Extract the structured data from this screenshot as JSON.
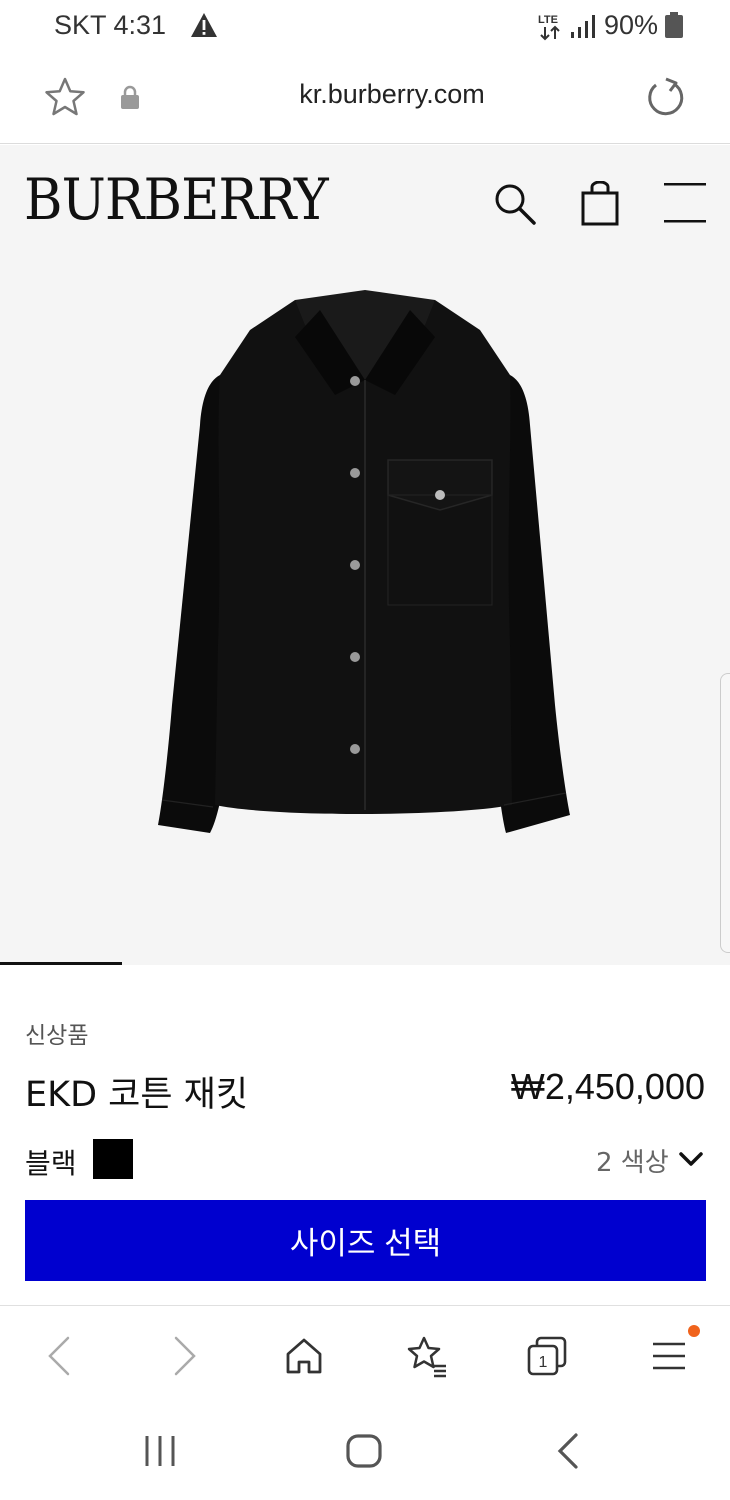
{
  "status_bar": {
    "carrier_time": "SKT 4:31",
    "battery": "90%",
    "icons": [
      "warning-icon",
      "lte-icon",
      "signal-icon",
      "battery-icon"
    ]
  },
  "browser": {
    "url": "kr.burberry.com",
    "icons": [
      "star-icon",
      "lock-icon",
      "reload-icon"
    ]
  },
  "site_header": {
    "logo": "BURBERRY",
    "icons": [
      "search-icon",
      "shopping-bag-icon",
      "menu-icon"
    ]
  },
  "product": {
    "badge": "신상품",
    "name": "EKD 코튼 재킷",
    "price": "₩2,450,000",
    "color_label": "블랙",
    "swatch_color": "#000000",
    "color_count": "2 색상",
    "size_button": "사이즈 선택",
    "accent_color": "#0000cf"
  },
  "browser_toolbar": {
    "icons": [
      "back-arrow-icon",
      "forward-arrow-icon",
      "home-icon",
      "bookmarks-icon",
      "tabs-icon",
      "menu-icon"
    ],
    "tab_count": "1",
    "notification_dot_color": "#f0631c"
  },
  "android_nav": {
    "icons": [
      "recent-apps-icon",
      "home-icon",
      "back-icon"
    ]
  }
}
